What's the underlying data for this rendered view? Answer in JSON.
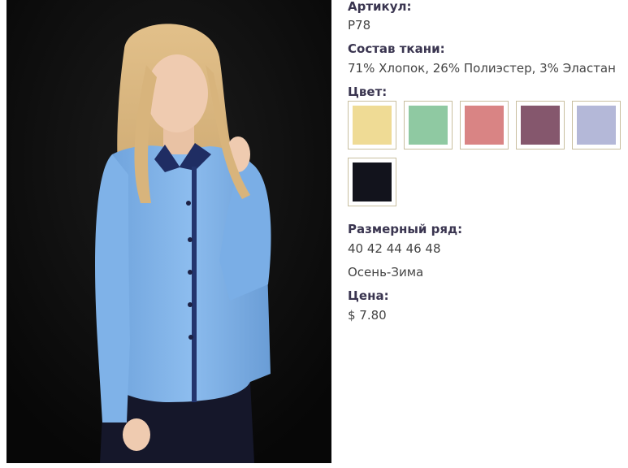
{
  "product": {
    "article_label": "Артикул:",
    "article_value": "P78",
    "fabric_label": "Состав ткани:",
    "fabric_value": "71% Хлопок, 26% Полиэстер, 3% Эластан",
    "color_label": "Цвет:",
    "colors": [
      {
        "name": "yellow",
        "hex": "#efdb95"
      },
      {
        "name": "mint",
        "hex": "#8fc9a2"
      },
      {
        "name": "pink",
        "hex": "#d98484"
      },
      {
        "name": "plum",
        "hex": "#85576d"
      },
      {
        "name": "lavender",
        "hex": "#b4b8d8"
      },
      {
        "name": "black",
        "hex": "#12131c"
      }
    ],
    "size_label": "Размерный ряд:",
    "size_value": "40 42 44 46 48",
    "season": "Осень-Зима",
    "price_label": "Цена:",
    "price_value": "$ 7.80"
  }
}
